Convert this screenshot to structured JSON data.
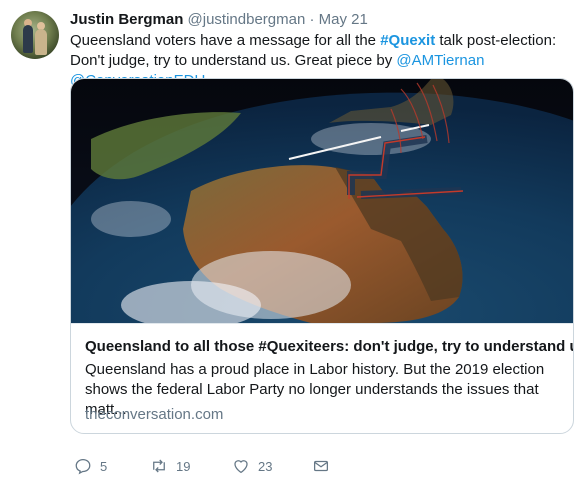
{
  "tweet": {
    "author_name": "Justin Bergman",
    "author_handle": "@justindbergman",
    "separator": "·",
    "date": "May 21",
    "text": {
      "part1": "Queensland voters have a message for all the ",
      "hashtag": "#Quexit",
      "part2": " talk post-election: Don't judge, try to understand us. Great piece by ",
      "mention1": "@AMTiernan",
      "space": " ",
      "mention2": "@ConversationEDU"
    }
  },
  "card": {
    "image_icon": "earth-australia-image",
    "title": "Queensland to all those #Quexiteers: don't judge, try to understand us",
    "description": "Queensland has a proud place in Labor history. But the 2019 election shows the federal Labor Party no longer understands the issues that matt...",
    "domain": "theconversation.com"
  },
  "actions": {
    "reply_count": "5",
    "retweet_count": "19",
    "like_count": "23",
    "icons": [
      "reply-icon",
      "retweet-icon",
      "like-icon",
      "message-icon"
    ]
  },
  "colors": {
    "link": "#1b95e0",
    "muted": "#657786",
    "text": "#14171a",
    "border": "#ccd6dd"
  }
}
